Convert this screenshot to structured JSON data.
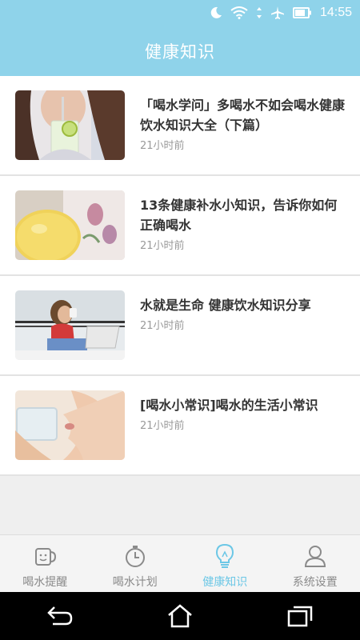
{
  "status_bar": {
    "time": "14:55",
    "icons": [
      "moon-icon",
      "wifi-icon",
      "data-arrows-icon",
      "airplane-icon",
      "battery-icon"
    ]
  },
  "header": {
    "title": "健康知识"
  },
  "articles": [
    {
      "title": "「喝水学问」多喝水不如会喝水健康饮水知识大全（下篇）",
      "time": "21小时前",
      "image": "woman-drinking-lemon-water"
    },
    {
      "title": "13条健康补水小知识，告诉你如何正确喝水",
      "time": "21小时前",
      "image": "lemon-and-floral-cup"
    },
    {
      "title": "水就是生命 健康饮水知识分享",
      "time": "21小时前",
      "image": "woman-drinking-at-laptop"
    },
    {
      "title": "[喝水小常识]喝水的生活小常识",
      "time": "21小时前",
      "image": "woman-drinking-glass-of-water"
    }
  ],
  "tab_bar": {
    "tabs": [
      {
        "label": "喝水提醒",
        "icon": "cup-icon",
        "active": false
      },
      {
        "label": "喝水计划",
        "icon": "stopwatch-icon",
        "active": false
      },
      {
        "label": "健康知识",
        "icon": "lightbulb-icon",
        "active": true
      },
      {
        "label": "系统设置",
        "icon": "person-icon",
        "active": false
      }
    ]
  },
  "colors": {
    "header_bg": "#8fd3ea",
    "active_tab": "#6cc7e6",
    "inactive_tab": "#8a8a8a"
  }
}
